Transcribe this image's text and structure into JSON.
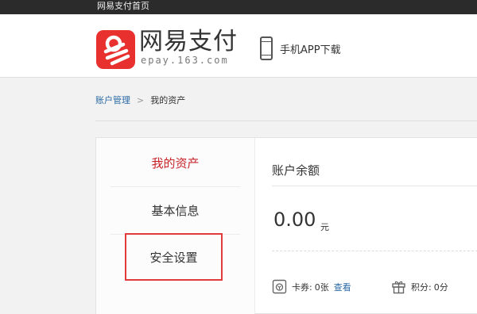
{
  "topbar": {
    "home_link": "网易支付首页"
  },
  "header": {
    "logo_title": "网易支付",
    "logo_subtitle": "epay.163.com",
    "app_download": "手机APP下载"
  },
  "breadcrumb": {
    "parent": "账户管理",
    "separator": ">",
    "current": "我的资产"
  },
  "sidebar": {
    "items": [
      {
        "label": "我的资产",
        "active": true
      },
      {
        "label": "基本信息",
        "active": false
      },
      {
        "label": "安全设置",
        "active": false
      }
    ]
  },
  "main": {
    "section_title": "账户余额",
    "balance": "0.00",
    "balance_unit": "元",
    "coupon": {
      "label": "卡券:",
      "value": "0张",
      "link": "查看"
    },
    "points": {
      "label": "积分:",
      "value": "0分"
    }
  },
  "colors": {
    "brand_red": "#e8312f",
    "active_red": "#c8242a",
    "link_blue": "#2a6aa5",
    "topbar": "#2b2b2b",
    "highlight_box": "#e23b3b"
  }
}
